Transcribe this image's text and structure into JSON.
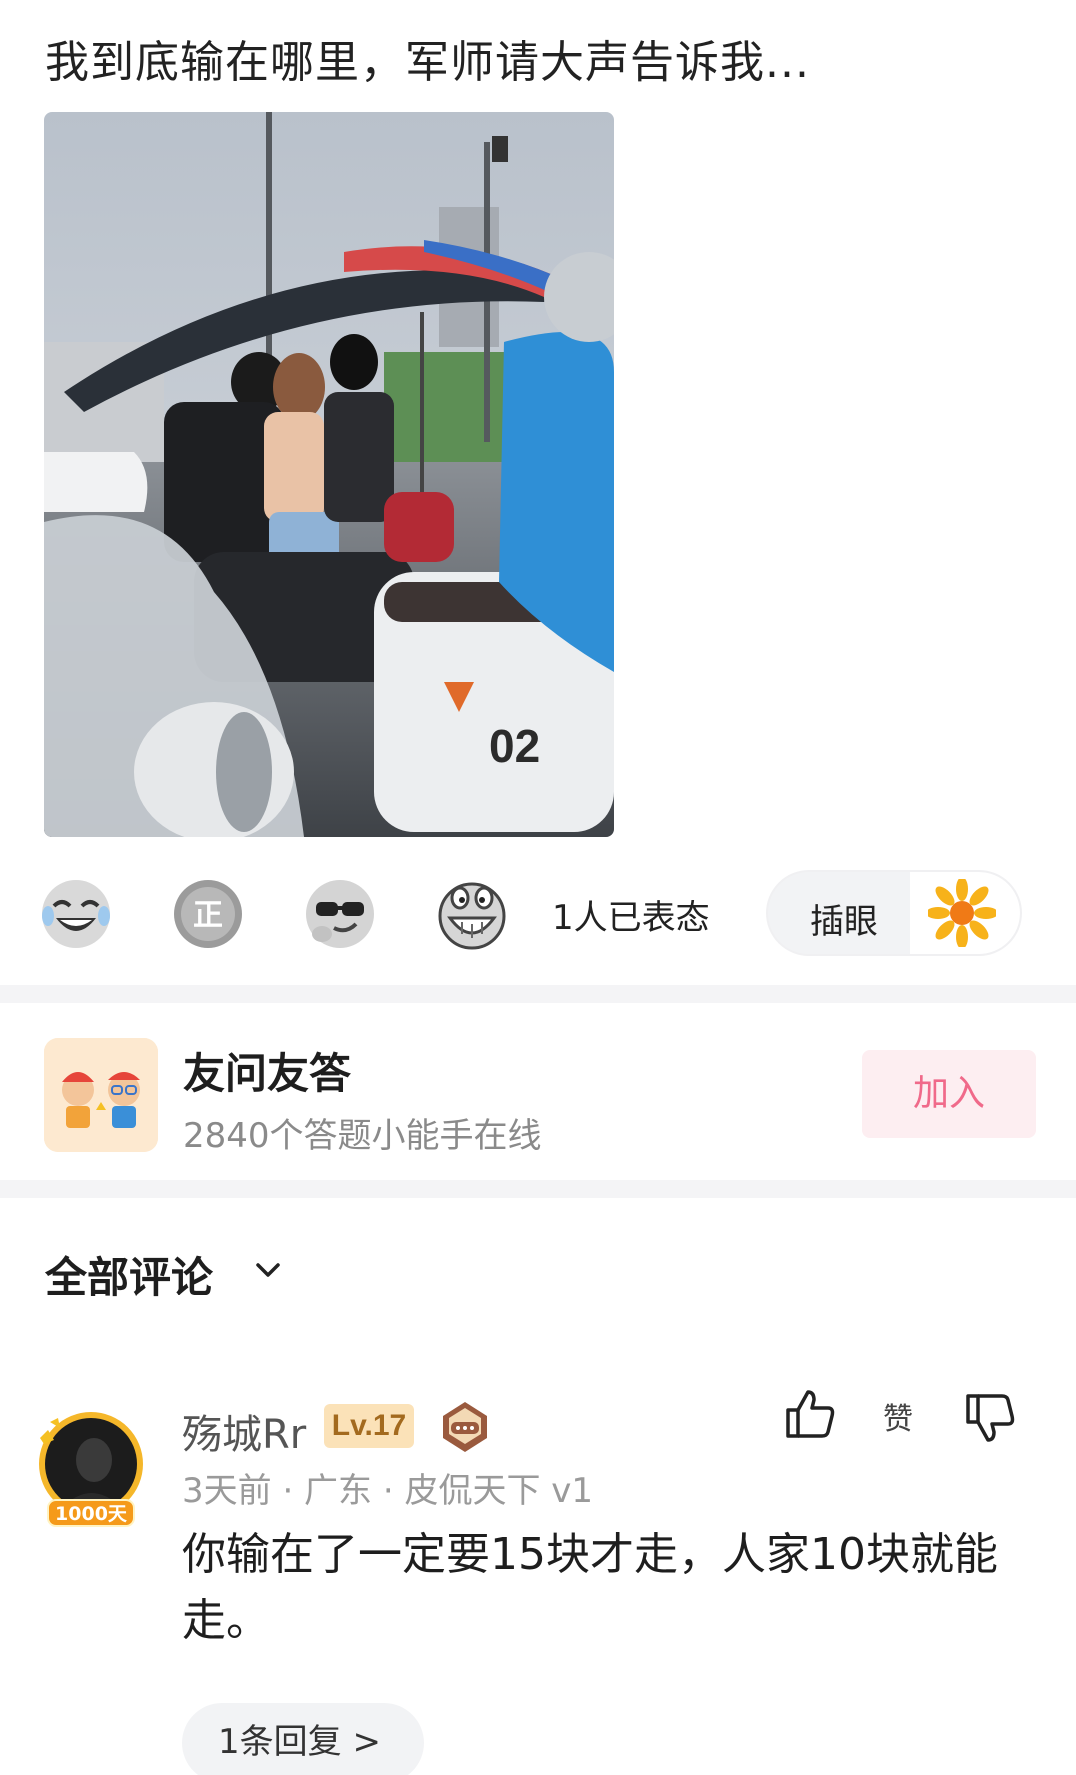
{
  "post": {
    "title": "我到底输在哪里，军师请大声告诉我..."
  },
  "photo": {
    "icon": "street-scene-photo",
    "scooter_plate": "02"
  },
  "reactions": {
    "emojis": [
      "laughing-tears-icon",
      "zheng-badge-icon",
      "sunglasses-face-icon",
      "grinning-face-icon"
    ],
    "count_text": "1人已表态",
    "poke_label": "插眼",
    "poke_icon": "flower-icon"
  },
  "community": {
    "name": "友问友答",
    "subtitle": "2840个答题小能手在线",
    "join_label": "加入"
  },
  "comments": {
    "header": "全部评论",
    "items": [
      {
        "username": "殇城Rr",
        "level": "Lv.17",
        "avatar_badge": "1000天",
        "meta": "3天前 · 广东 · 皮侃天下 v1",
        "text": "你输在了一定要15块才走，人家10块就能走。",
        "like_label": "赞",
        "reply_label": "1条回复 >"
      }
    ]
  },
  "colors": {
    "accent_pink": "#f06a8a",
    "join_bg": "#fdeef1",
    "level_bg": "#fbe2b8",
    "divider": "#f4f4f6"
  }
}
